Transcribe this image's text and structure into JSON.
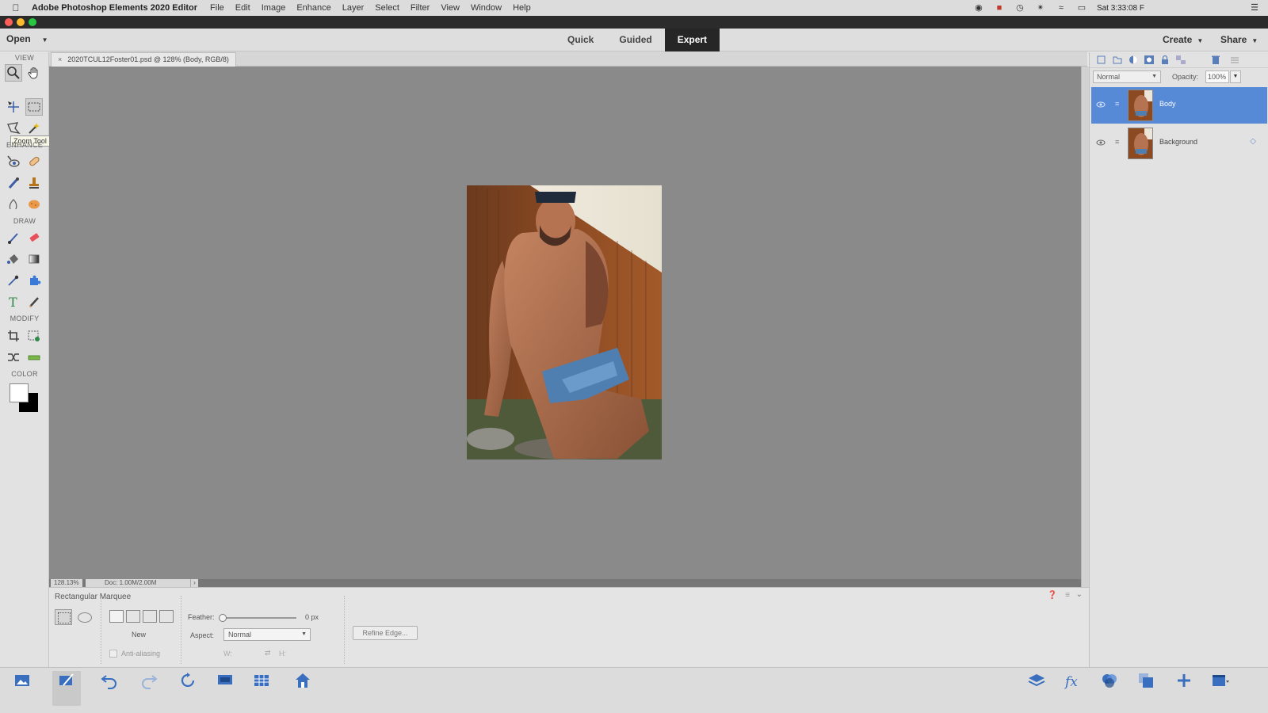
{
  "menubar": {
    "app_name": "Adobe Photoshop Elements 2020 Editor",
    "items": [
      "File",
      "Edit",
      "Image",
      "Enhance",
      "Layer",
      "Select",
      "Filter",
      "View",
      "Window",
      "Help"
    ],
    "clock": "Sat 3:33:08 F"
  },
  "modebar": {
    "open_label": "Open",
    "tabs": [
      {
        "label": "Quick"
      },
      {
        "label": "Guided"
      },
      {
        "label": "Expert",
        "active": true
      }
    ],
    "create_label": "Create",
    "share_label": "Share"
  },
  "toolbar": {
    "sections": {
      "view": "VIEW",
      "enhance": "ENHANCE",
      "draw": "DRAW",
      "modify": "MODIFY",
      "color": "COLOR"
    },
    "tooltip": "Zoom Tool (Z)",
    "foreground_color": "#ffffff",
    "background_color": "#000000"
  },
  "document": {
    "tab_label": "2020TCUL12Foster01.psd @ 128% (Body, RGB/8)",
    "zoom_readout": "128.13%",
    "doc_readout": "Doc: 1.00M/2.00M"
  },
  "tool_options": {
    "title": "Rectangular Marquee",
    "new_label": "New",
    "anti_alias_label": "Anti-aliasing",
    "feather_label": "Feather:",
    "feather_value": "0 px",
    "aspect_label": "Aspect:",
    "aspect_value": "Normal",
    "w_label": "W:",
    "h_label": "H:",
    "refine_edge_label": "Refine Edge..."
  },
  "layers_panel": {
    "blend_mode": "Normal",
    "opacity_label": "Opacity:",
    "opacity_value": "100%",
    "layers": [
      {
        "name": "Body",
        "selected": true
      },
      {
        "name": "Background",
        "selected": false
      }
    ]
  },
  "colors": {
    "accent": "#5689d6",
    "canvas": "#8a8a8a",
    "active_tab": "#262626"
  }
}
